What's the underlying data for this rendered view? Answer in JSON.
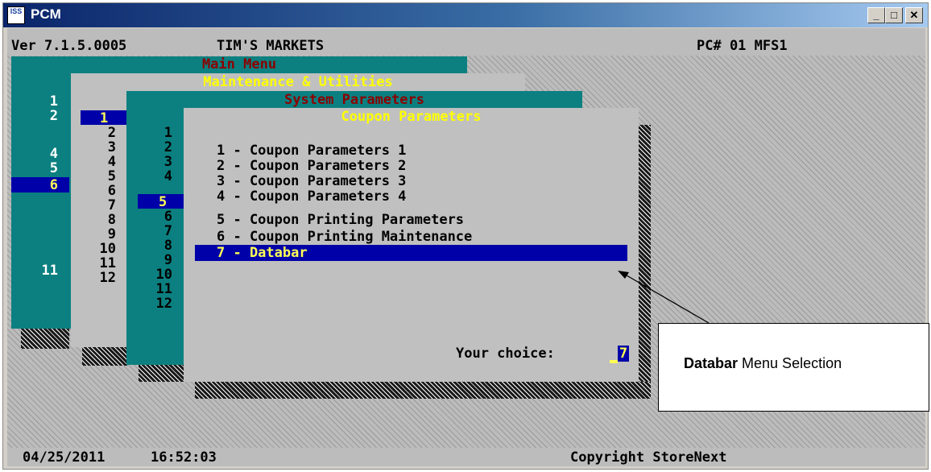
{
  "window": {
    "title": "PCM",
    "icon_text": "ISS",
    "minimize_glyph": "_",
    "maximize_glyph": "□",
    "close_glyph": "✕"
  },
  "header": {
    "version": "Ver 7.1.5.0005",
    "store": "TIM'S MARKETS",
    "pc": "PC# 01 MFS1"
  },
  "main_menu": {
    "title": "Main Menu",
    "numbers": [
      "1",
      "2",
      "4",
      "5",
      "6",
      "11"
    ],
    "selected": "6"
  },
  "maintenance_menu": {
    "title": "Maintenance & Utilities",
    "numbers": [
      "1",
      "2",
      "3",
      "4",
      "5",
      "6",
      "7",
      "8",
      "9",
      "10",
      "11",
      "12"
    ],
    "selected": "1"
  },
  "system_parameters": {
    "title": "System Parameters",
    "numbers": [
      "1",
      "2",
      "3",
      "4",
      "5",
      "6",
      "7",
      "8",
      "9",
      "10",
      "11",
      "12"
    ],
    "selected": "5"
  },
  "coupon_parameters": {
    "title": "Coupon Parameters",
    "items": [
      "1 - Coupon Parameters 1",
      "2 - Coupon Parameters 2",
      "3 - Coupon Parameters 3",
      "4 - Coupon Parameters 4",
      "5 - Coupon Printing Parameters",
      "6 - Coupon Printing Maintenance",
      "7 - Databar"
    ],
    "selected_index": 6,
    "prompt_label": "Your choice:",
    "prompt_value": "7"
  },
  "callout": {
    "bold": "Databar",
    "rest": " Menu Selection"
  },
  "footer": {
    "date": "04/25/2011",
    "time": "16:52:03",
    "copyright": "Copyright StoreNext"
  }
}
